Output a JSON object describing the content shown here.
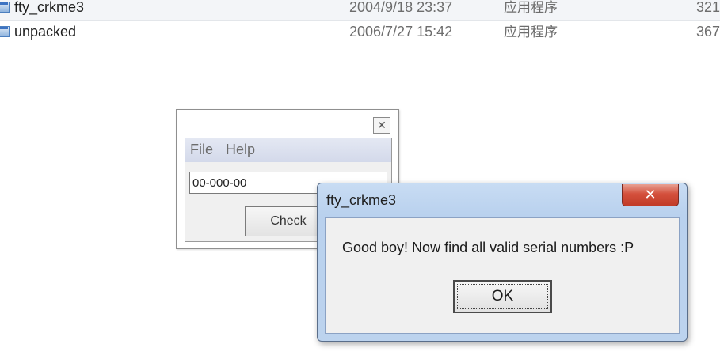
{
  "files": [
    {
      "name": "fty_crkme3",
      "date": "2004/9/18 23:37",
      "type": "应用程序",
      "size": "321"
    },
    {
      "name": "unpacked",
      "date": "2006/7/27 15:42",
      "type": "应用程序",
      "size": "367"
    }
  ],
  "crackme": {
    "menu": {
      "file": "File",
      "help": "Help"
    },
    "serial_value": "00-000-00",
    "check_label": "Check",
    "close_glyph": "✕"
  },
  "messagebox": {
    "title": "fty_crkme3",
    "close_glyph": "✕",
    "message": "Good boy! Now find all valid serial numbers :P",
    "ok_label": "OK"
  }
}
